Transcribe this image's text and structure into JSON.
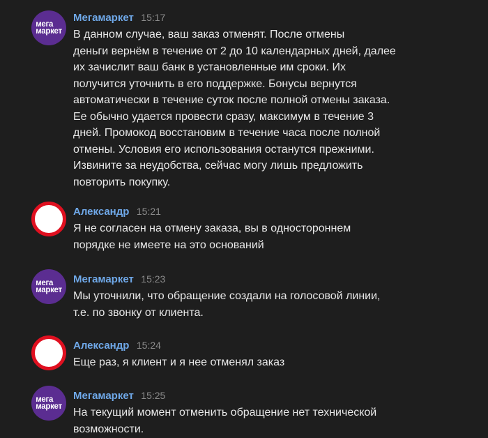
{
  "messages": [
    {
      "author": "Мегамаркет",
      "time": "15:17",
      "avatar": {
        "type": "megamarket-logo",
        "line1": "мега",
        "line2": "маркет",
        "color": "#5b2d91"
      },
      "lines": [
        "В данном случае, ваш заказ отменят. После отмены",
        "деньги вернём в течение от 2 до 10 календарных дней, далее",
        "их зачислит ваш банк в установленные им сроки. Их",
        "получится уточнить в его поддержке. Бонусы вернутся",
        "автоматически в течение суток после полной отмены заказа.",
        "Ее обычно удается провести сразу, максимум в течение 3",
        "дней. Промокод восстановим в течение часа после полной",
        "отмены. Условия его использования останутся прежними.",
        "Извините за неудобства, сейчас могу лишь предложить",
        "повторить покупку."
      ]
    },
    {
      "author": "Александр",
      "time": "15:21",
      "avatar": {
        "type": "redacted-circle",
        "color": "#e01020"
      },
      "lines": [
        "Я не согласен на отмену заказа, вы в одностороннем",
        "порядке не имеете на это оснований"
      ]
    },
    {
      "author": "Мегамаркет",
      "time": "15:23",
      "avatar": {
        "type": "megamarket-logo",
        "line1": "мега",
        "line2": "маркет",
        "color": "#5b2d91"
      },
      "lines": [
        "Мы уточнили, что обращение создали на голосовой линии,",
        "т.е. по звонку от клиента."
      ]
    },
    {
      "author": "Александр",
      "time": "15:24",
      "avatar": {
        "type": "redacted-circle",
        "color": "#e01020"
      },
      "lines": [
        "Еще раз, я клиент и я нее отменял заказ"
      ]
    },
    {
      "author": "Мегамаркет",
      "time": "15:25",
      "avatar": {
        "type": "megamarket-logo",
        "line1": "мега",
        "line2": "маркет",
        "color": "#5b2d91"
      },
      "lines": [
        "На текущий момент отменить обращение нет технической",
        "возможности."
      ]
    }
  ]
}
